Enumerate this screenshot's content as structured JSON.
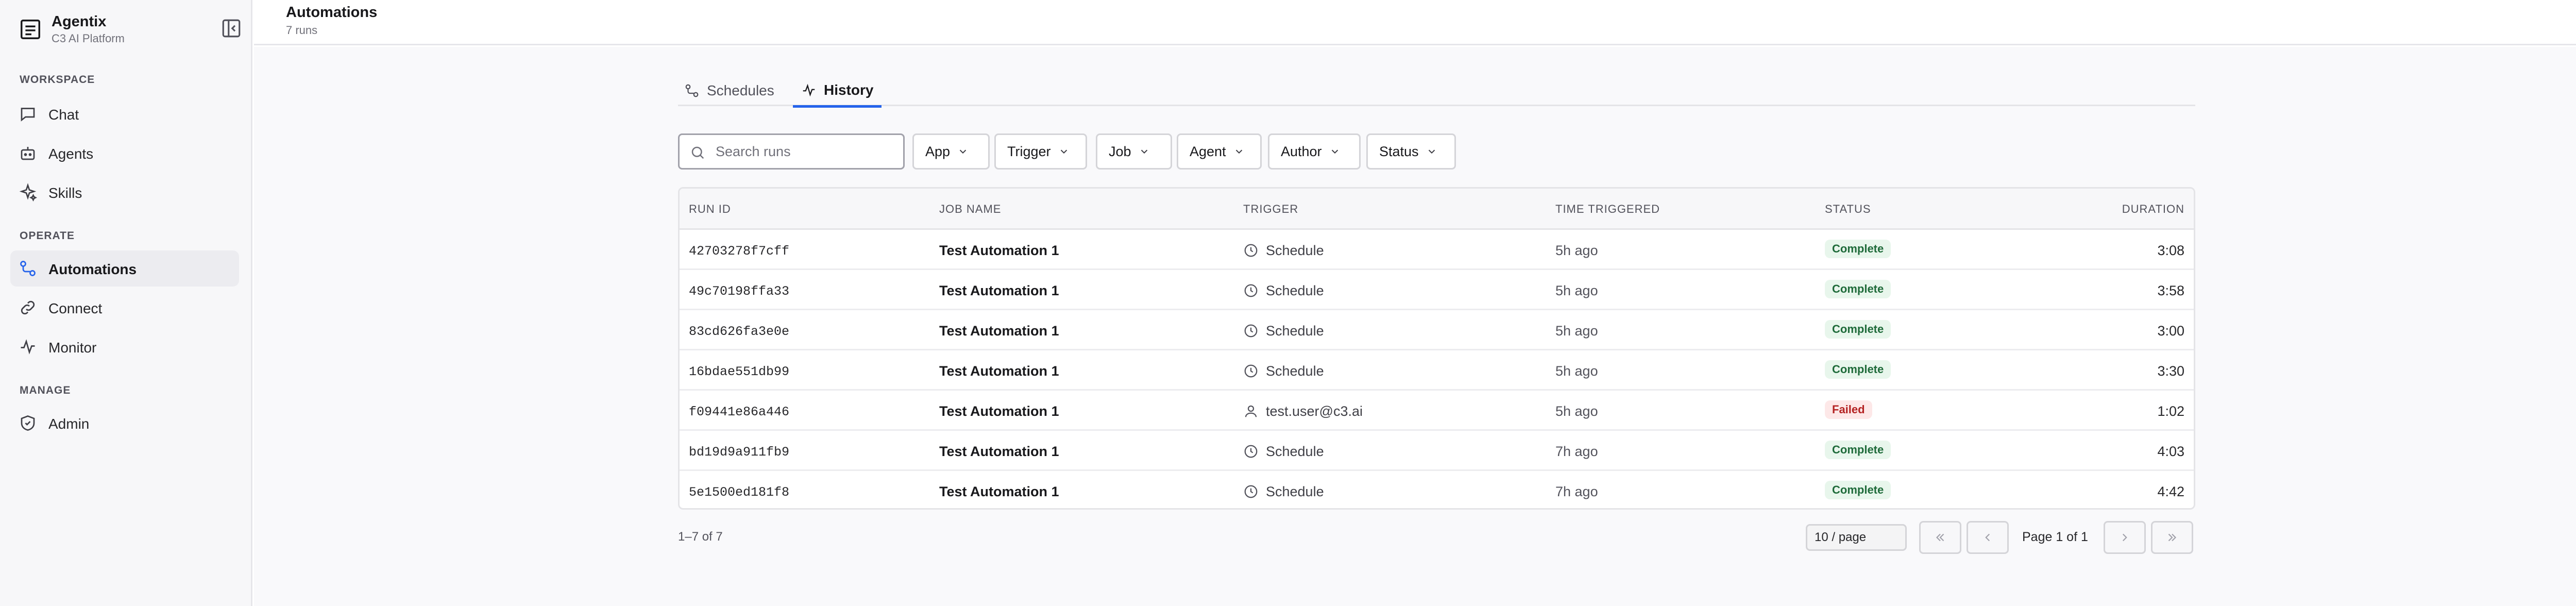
{
  "app": {
    "name": "Agentix",
    "subtitle": "C3 AI Platform"
  },
  "sidebar": {
    "sections": [
      {
        "label": "Workspace",
        "items": [
          {
            "label": "Chat",
            "icon": "chat-icon"
          },
          {
            "label": "Agents",
            "icon": "bot-icon"
          },
          {
            "label": "Skills",
            "icon": "sparkles-icon"
          }
        ]
      },
      {
        "label": "Operate",
        "items": [
          {
            "label": "Automations",
            "icon": "workflow-icon",
            "active": true
          },
          {
            "label": "Connect",
            "icon": "link-icon"
          },
          {
            "label": "Monitor",
            "icon": "activity-icon"
          }
        ]
      },
      {
        "label": "Manage",
        "items": [
          {
            "label": "Admin",
            "icon": "shield-icon"
          }
        ]
      }
    ]
  },
  "header": {
    "title": "Automations",
    "subtitle": "7 runs"
  },
  "tabs": [
    {
      "label": "Schedules",
      "icon": "workflow-icon",
      "active": false
    },
    {
      "label": "History",
      "icon": "activity-icon",
      "active": true
    }
  ],
  "search": {
    "placeholder": "Search runs",
    "value": ""
  },
  "filters": [
    "App",
    "Trigger",
    "Job",
    "Agent",
    "Author",
    "Status"
  ],
  "table": {
    "columns": [
      "Run ID",
      "Job Name",
      "Trigger",
      "Time Triggered",
      "Status",
      "Duration"
    ],
    "rows": [
      {
        "run_id": "42703278f7cff",
        "job": "Test Automation 1",
        "trigger": "Schedule",
        "trigger_icon": "clock-icon",
        "time": "5h ago",
        "status": "Complete",
        "duration": "3:08"
      },
      {
        "run_id": "49c70198ffa33",
        "job": "Test Automation 1",
        "trigger": "Schedule",
        "trigger_icon": "clock-icon",
        "time": "5h ago",
        "status": "Complete",
        "duration": "3:58"
      },
      {
        "run_id": "83cd626fa3e0e",
        "job": "Test Automation 1",
        "trigger": "Schedule",
        "trigger_icon": "clock-icon",
        "time": "5h ago",
        "status": "Complete",
        "duration": "3:00"
      },
      {
        "run_id": "16bdae551db99",
        "job": "Test Automation 1",
        "trigger": "Schedule",
        "trigger_icon": "clock-icon",
        "time": "5h ago",
        "status": "Complete",
        "duration": "3:30"
      },
      {
        "run_id": "f09441e86a446",
        "job": "Test Automation 1",
        "trigger": "test.user@c3.ai",
        "trigger_icon": "user-icon",
        "time": "5h ago",
        "status": "Failed",
        "duration": "1:02"
      },
      {
        "run_id": "bd19d9a911fb9",
        "job": "Test Automation 1",
        "trigger": "Schedule",
        "trigger_icon": "clock-icon",
        "time": "7h ago",
        "status": "Complete",
        "duration": "4:03"
      },
      {
        "run_id": "5e1500ed181f8",
        "job": "Test Automation 1",
        "trigger": "Schedule",
        "trigger_icon": "clock-icon",
        "time": "7h ago",
        "status": "Complete",
        "duration": "4:42"
      }
    ]
  },
  "pagination": {
    "range": "1–7 of 7",
    "page_size": "10 / page",
    "page_label": "Page 1 of 1"
  },
  "colors": {
    "accent": "#2563eb",
    "complete_bg": "#e8f6ec",
    "complete_fg": "#1f6b3a",
    "failed_bg": "#fde8e8",
    "failed_fg": "#b42323"
  }
}
